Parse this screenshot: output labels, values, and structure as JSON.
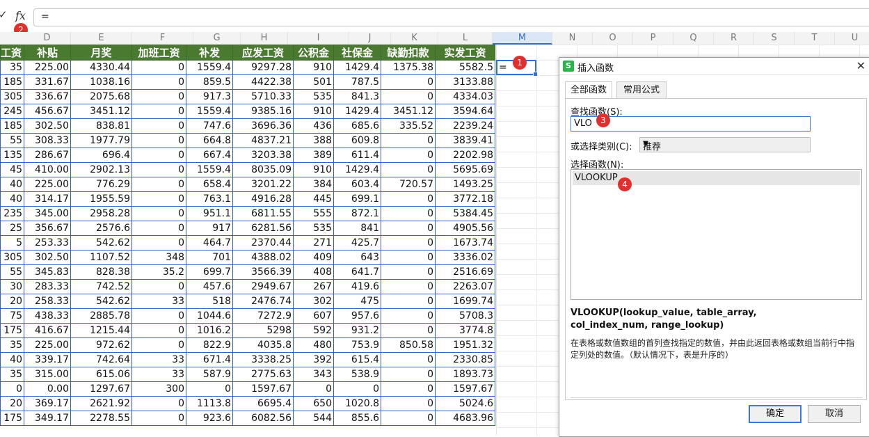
{
  "formula_bar": {
    "value": "=",
    "fx_label": "fx"
  },
  "badges": {
    "b1": "1",
    "b2": "2",
    "b3": "3",
    "b4": "4"
  },
  "column_letters": [
    "D",
    "E",
    "F",
    "G",
    "H",
    "I",
    "J",
    "K",
    "L",
    "M",
    "N",
    "O",
    "P",
    "Q",
    "R",
    "S",
    "T",
    "U"
  ],
  "selected_column": "M",
  "table": {
    "headers": [
      "工资",
      "补贴",
      "月奖",
      "加班工资",
      "补发",
      "应发工资",
      "公积金",
      "社保金",
      "缺勤扣款",
      "实发工资"
    ],
    "rows": [
      [
        "35",
        "225.00",
        "4330.44",
        "0",
        "1559.4",
        "9297.28",
        "910",
        "1429.4",
        "1375.38",
        "5582.5"
      ],
      [
        "185",
        "331.67",
        "1038.16",
        "0",
        "859.5",
        "4422.38",
        "501",
        "787.5",
        "0",
        "3133.88"
      ],
      [
        "305",
        "336.67",
        "2075.68",
        "0",
        "917.3",
        "5710.33",
        "535",
        "841.3",
        "0",
        "4334.03"
      ],
      [
        "245",
        "456.67",
        "3451.12",
        "0",
        "1559.4",
        "9385.16",
        "910",
        "1429.4",
        "3451.12",
        "3594.64"
      ],
      [
        "185",
        "302.50",
        "838.81",
        "0",
        "747.6",
        "3696.36",
        "436",
        "685.6",
        "335.52",
        "2239.24"
      ],
      [
        "55",
        "308.33",
        "1977.79",
        "0",
        "664.8",
        "4837.21",
        "388",
        "609.8",
        "0",
        "3839.41"
      ],
      [
        "135",
        "286.67",
        "696.4",
        "0",
        "667.4",
        "3203.38",
        "389",
        "611.4",
        "0",
        "2202.98"
      ],
      [
        "45",
        "410.00",
        "2902.13",
        "0",
        "1559.4",
        "8035.09",
        "910",
        "1429.4",
        "0",
        "5695.69"
      ],
      [
        "40",
        "225.00",
        "776.29",
        "0",
        "658.4",
        "3201.22",
        "384",
        "603.4",
        "720.57",
        "1493.25"
      ],
      [
        "40",
        "314.17",
        "1955.59",
        "0",
        "763.1",
        "4916.28",
        "445",
        "699.1",
        "0",
        "3772.18"
      ],
      [
        "235",
        "345.00",
        "2958.28",
        "0",
        "951.1",
        "6811.55",
        "555",
        "872.1",
        "0",
        "5384.45"
      ],
      [
        "25",
        "356.67",
        "2576.6",
        "0",
        "917",
        "6281.56",
        "535",
        "841",
        "0",
        "4905.56"
      ],
      [
        "5",
        "253.33",
        "542.62",
        "0",
        "464.7",
        "2370.44",
        "271",
        "425.7",
        "0",
        "1673.74"
      ],
      [
        "305",
        "302.50",
        "1107.52",
        "348",
        "701",
        "4388.02",
        "409",
        "643",
        "0",
        "3336.02"
      ],
      [
        "55",
        "345.83",
        "828.38",
        "35.2",
        "699.7",
        "3566.39",
        "408",
        "641.7",
        "0",
        "2516.69"
      ],
      [
        "30",
        "283.33",
        "742.52",
        "0",
        "457.6",
        "2949.67",
        "267",
        "419.6",
        "0",
        "2263.07"
      ],
      [
        "20",
        "258.33",
        "542.62",
        "33",
        "518",
        "2476.74",
        "302",
        "475",
        "0",
        "1699.74"
      ],
      [
        "75",
        "438.33",
        "2885.78",
        "0",
        "1044.6",
        "7272.9",
        "607",
        "957.6",
        "0",
        "5708.3"
      ],
      [
        "175",
        "416.67",
        "1215.44",
        "0",
        "1016.2",
        "5298",
        "592",
        "931.2",
        "0",
        "3774.8"
      ],
      [
        "35",
        "225.00",
        "972.62",
        "0",
        "822.9",
        "4035.8",
        "480",
        "753.9",
        "850.58",
        "1951.32"
      ],
      [
        "40",
        "339.17",
        "742.64",
        "33",
        "671.4",
        "3338.25",
        "392",
        "615.4",
        "0",
        "2330.85"
      ],
      [
        "35",
        "315.00",
        "615.06",
        "33",
        "587.9",
        "2775.63",
        "343",
        "538.9",
        "0",
        "1893.73"
      ],
      [
        "0",
        "0.00",
        "1297.67",
        "300",
        "0",
        "1597.67",
        "0",
        "0",
        "0",
        "1597.67"
      ],
      [
        "20",
        "369.17",
        "2621.92",
        "0",
        "1113.8",
        "6695.4",
        "650",
        "1020.8",
        "0",
        "5024.6"
      ],
      [
        "175",
        "349.17",
        "2278.55",
        "0",
        "923.6",
        "6082.56",
        "544",
        "855.6",
        "0",
        "4683.96"
      ]
    ]
  },
  "active_cell": {
    "value": "="
  },
  "dialog": {
    "title": "插入函数",
    "app_icon_letter": "S",
    "close_glyph": "✕",
    "tabs": [
      "全部函数",
      "常用公式"
    ],
    "search_label": "查找函数(S):",
    "search_value": "VLO",
    "category_label": "或选择类别(C):",
    "category_value": "推荐",
    "select_label": "选择函数(N):",
    "selected_function": "VLOOKUP",
    "signature": "VLOOKUP(lookup_value, table_array, col_index_num, range_lookup)",
    "description": "在表格或数值数组的首列查找指定的数值，并由此返回表格或数组当前行中指定列处的数值。（默认情况下，表是升序的）",
    "ok_label": "确定",
    "cancel_label": "取消"
  }
}
